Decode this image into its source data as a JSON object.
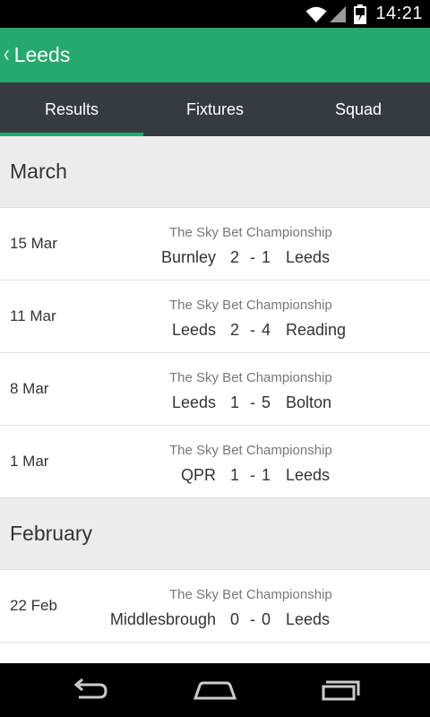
{
  "colors": {
    "app_bar": "#26a96c",
    "tab_bar": "#343b41",
    "accent": "#26a96c"
  },
  "status_bar": {
    "time": "14:21",
    "icons": [
      "wifi-icon",
      "signal-icon",
      "battery-icon"
    ]
  },
  "app_bar": {
    "back_icon": "chevron-left-icon",
    "title": "Leeds"
  },
  "tabs": [
    {
      "label": "Results",
      "active": true
    },
    {
      "label": "Fixtures",
      "active": false
    },
    {
      "label": "Squad",
      "active": false
    }
  ],
  "months": [
    {
      "name": "March",
      "matches": [
        {
          "date": "15 Mar",
          "competition": "The Sky Bet Championship",
          "home": "Burnley",
          "home_score": "2",
          "separator": "-",
          "away_score": "1",
          "away": "Leeds"
        },
        {
          "date": "11 Mar",
          "competition": "The Sky Bet Championship",
          "home": "Leeds",
          "home_score": "2",
          "separator": "-",
          "away_score": "4",
          "away": "Reading"
        },
        {
          "date": "8 Mar",
          "competition": "The Sky Bet Championship",
          "home": "Leeds",
          "home_score": "1",
          "separator": "-",
          "away_score": "5",
          "away": "Bolton"
        },
        {
          "date": "1 Mar",
          "competition": "The Sky Bet Championship",
          "home": "QPR",
          "home_score": "1",
          "separator": "-",
          "away_score": "1",
          "away": "Leeds"
        }
      ]
    },
    {
      "name": "February",
      "matches": [
        {
          "date": "22 Feb",
          "competition": "The Sky Bet Championship",
          "home": "Middlesbrough",
          "home_score": "0",
          "separator": "-",
          "away_score": "0",
          "away": "Leeds"
        }
      ]
    }
  ],
  "nav_bar": {
    "icons": [
      "back-icon",
      "home-icon",
      "recent-apps-icon"
    ]
  }
}
